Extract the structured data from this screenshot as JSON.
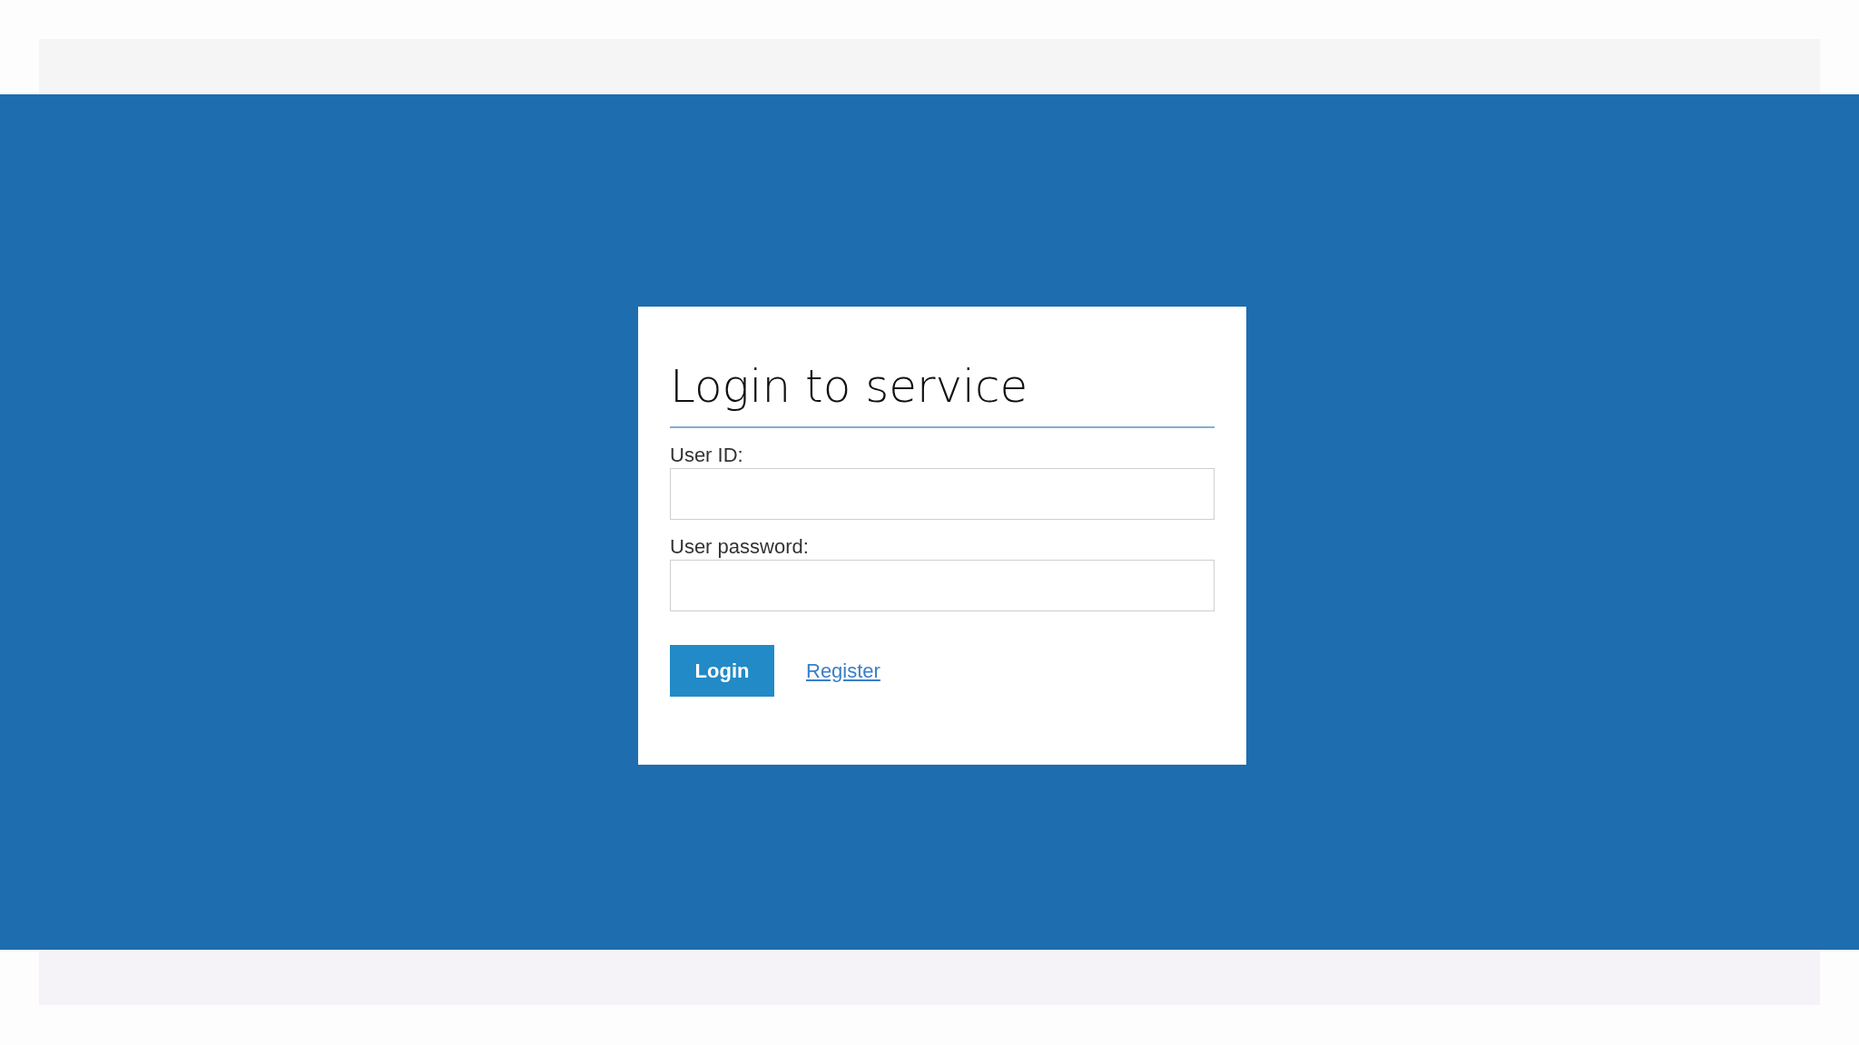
{
  "login_form": {
    "title": "Login to service",
    "fields": [
      {
        "label": "User ID:"
      },
      {
        "label": "User password:"
      }
    ],
    "login_button": "Login",
    "register_link": "Register"
  }
}
